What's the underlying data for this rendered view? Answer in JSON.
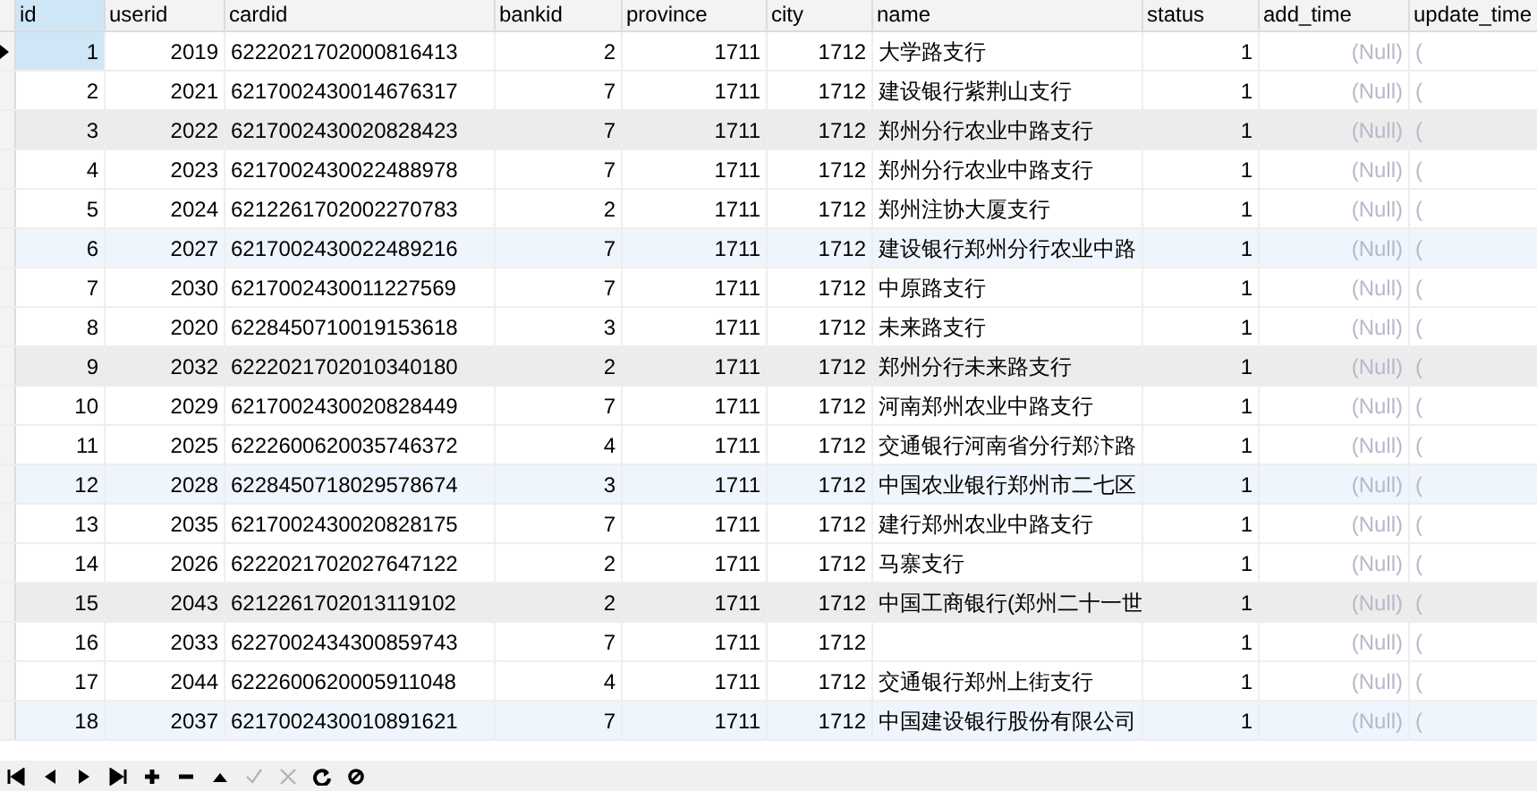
{
  "table": {
    "columns": [
      "id",
      "userid",
      "cardid",
      "bankid",
      "province",
      "city",
      "name",
      "status",
      "add_time",
      "update_time"
    ],
    "rows": [
      {
        "selected": true,
        "color": "#ffffff",
        "cells": [
          "1",
          "2019",
          "6222021702000816413",
          "2",
          "1711",
          "1712",
          "大学路支行",
          "1",
          "(Null)",
          "("
        ]
      },
      {
        "selected": false,
        "color": "#ffffff",
        "cells": [
          "2",
          "2021",
          "6217002430014676317",
          "7",
          "1711",
          "1712",
          "建设银行紫荆山支行",
          "1",
          "(Null)",
          "("
        ]
      },
      {
        "selected": false,
        "color": "#ececec",
        "cells": [
          "3",
          "2022",
          "6217002430020828423",
          "7",
          "1711",
          "1712",
          "郑州分行农业中路支行",
          "1",
          "(Null)",
          "("
        ]
      },
      {
        "selected": false,
        "color": "#ffffff",
        "cells": [
          "4",
          "2023",
          "6217002430022488978",
          "7",
          "1711",
          "1712",
          "郑州分行农业中路支行",
          "1",
          "(Null)",
          "("
        ]
      },
      {
        "selected": false,
        "color": "#ffffff",
        "cells": [
          "5",
          "2024",
          "6212261702002270783",
          "2",
          "1711",
          "1712",
          "郑州注协大厦支行",
          "1",
          "(Null)",
          "("
        ]
      },
      {
        "selected": false,
        "color": "#eef5fc",
        "cells": [
          "6",
          "2027",
          "6217002430022489216",
          "7",
          "1711",
          "1712",
          "建设银行郑州分行农业中路",
          "1",
          "(Null)",
          "("
        ]
      },
      {
        "selected": false,
        "color": "#ffffff",
        "cells": [
          "7",
          "2030",
          "6217002430011227569",
          "7",
          "1711",
          "1712",
          "中原路支行",
          "1",
          "(Null)",
          "("
        ]
      },
      {
        "selected": false,
        "color": "#ffffff",
        "cells": [
          "8",
          "2020",
          "6228450710019153618",
          "3",
          "1711",
          "1712",
          "未来路支行",
          "1",
          "(Null)",
          "("
        ]
      },
      {
        "selected": false,
        "color": "#ececec",
        "cells": [
          "9",
          "2032",
          "6222021702010340180",
          "2",
          "1711",
          "1712",
          "郑州分行未来路支行",
          "1",
          "(Null)",
          "("
        ]
      },
      {
        "selected": false,
        "color": "#ffffff",
        "cells": [
          "10",
          "2029",
          "6217002430020828449",
          "7",
          "1711",
          "1712",
          "河南郑州农业中路支行",
          "1",
          "(Null)",
          "("
        ]
      },
      {
        "selected": false,
        "color": "#ffffff",
        "cells": [
          "11",
          "2025",
          "6222600620035746372",
          "4",
          "1711",
          "1712",
          "交通银行河南省分行郑汴路",
          "1",
          "(Null)",
          "("
        ]
      },
      {
        "selected": false,
        "color": "#eef5fc",
        "cells": [
          "12",
          "2028",
          "6228450718029578674",
          "3",
          "1711",
          "1712",
          "中国农业银行郑州市二七区",
          "1",
          "(Null)",
          "("
        ]
      },
      {
        "selected": false,
        "color": "#ffffff",
        "cells": [
          "13",
          "2035",
          "6217002430020828175",
          "7",
          "1711",
          "1712",
          "建行郑州农业中路支行",
          "1",
          "(Null)",
          "("
        ]
      },
      {
        "selected": false,
        "color": "#ffffff",
        "cells": [
          "14",
          "2026",
          "6222021702027647122",
          "2",
          "1711",
          "1712",
          "马寨支行",
          "1",
          "(Null)",
          "("
        ]
      },
      {
        "selected": false,
        "color": "#ececec",
        "cells": [
          "15",
          "2043",
          "6212261702013119102",
          "2",
          "1711",
          "1712",
          "中国工商银行(郑州二十一世",
          "1",
          "(Null)",
          "("
        ]
      },
      {
        "selected": false,
        "color": "#ffffff",
        "cells": [
          "16",
          "2033",
          "6227002434300859743",
          "7",
          "1711",
          "1712",
          null,
          "1",
          "(Null)",
          "("
        ]
      },
      {
        "selected": false,
        "color": "#ffffff",
        "cells": [
          "17",
          "2044",
          "6222600620005911048",
          "4",
          "1711",
          "1712",
          "交通银行郑州上街支行",
          "1",
          "(Null)",
          "("
        ]
      },
      {
        "selected": false,
        "color": "#eef5fc",
        "cells": [
          "18",
          "2037",
          "6217002430010891621",
          "7",
          "1711",
          "1712",
          "中国建设银行股份有限公司",
          "1",
          "(Null)",
          "("
        ]
      }
    ]
  },
  "toolbar": [
    {
      "disabled": false
    },
    {
      "disabled": false
    },
    {
      "disabled": false
    },
    {
      "disabled": false
    },
    {
      "disabled": false
    },
    {
      "disabled": false
    },
    {
      "disabled": false
    },
    {
      "disabled": true
    },
    {
      "disabled": true
    },
    {
      "disabled": false
    },
    {
      "disabled": false
    }
  ]
}
